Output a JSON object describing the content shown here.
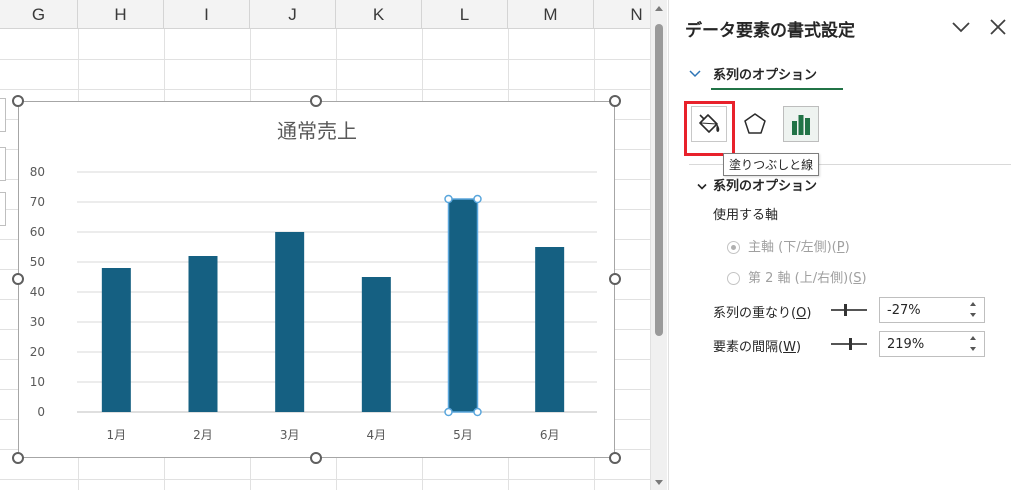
{
  "sheet": {
    "columns": [
      "G",
      "H",
      "I",
      "J",
      "K",
      "L",
      "M",
      "N"
    ]
  },
  "chart_data": {
    "type": "bar",
    "title": "通常売上",
    "categories": [
      "1月",
      "2月",
      "3月",
      "4月",
      "5月",
      "6月"
    ],
    "values": [
      48,
      52,
      60,
      45,
      71,
      55
    ],
    "ylim": [
      0,
      80
    ],
    "yticks": [
      "0",
      "10",
      "20",
      "30",
      "40",
      "50",
      "60",
      "70",
      "80"
    ],
    "grid": true,
    "selected_index": 4,
    "bar_color": "#156082",
    "selection_color": "#5aa6dc"
  },
  "pane": {
    "title": "データ要素の書式設定",
    "tab_label": "系列のオプション",
    "tooltip": "塗りつぶしと線",
    "section_label": "系列のオプション",
    "axis_label": "使用する軸",
    "primary_axis": {
      "text": "主軸 (下/左側)(",
      "key": "P",
      "end": ")"
    },
    "secondary_axis": {
      "text": "第 2 軸 (上/右側)(",
      "key": "S",
      "end": ")"
    },
    "overlap": {
      "text": "系列の重なり(",
      "key": "O",
      "end": ")",
      "value": "-27%"
    },
    "gap": {
      "text": "要素の間隔(",
      "key": "W",
      "end": ")",
      "value": "219%"
    },
    "accent_color": "#217346",
    "highlight_color": "#e8212b"
  },
  "icons": {
    "fill": "paint-bucket-icon",
    "effects": "pentagon-icon",
    "options": "bar-chart-icon"
  }
}
